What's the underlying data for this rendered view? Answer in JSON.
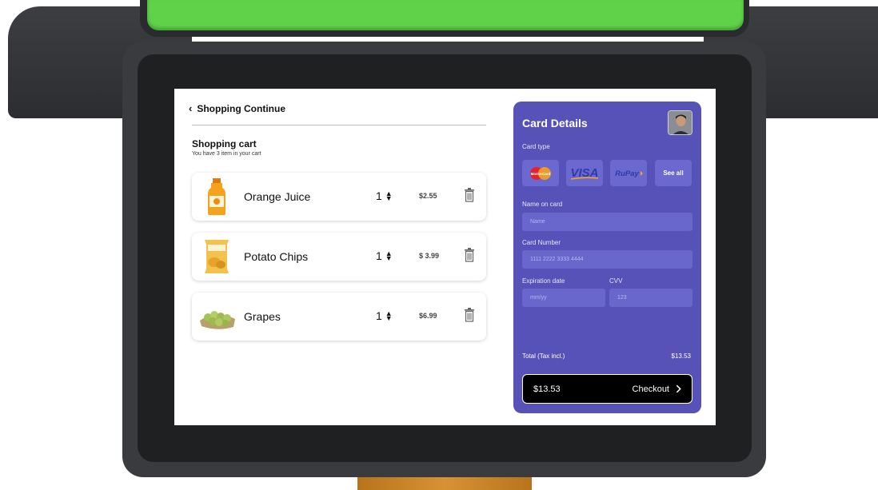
{
  "cart": {
    "back_label": "Shopping Continue",
    "title": "Shopping cart",
    "subtitle": "You have 3 item in your cart",
    "items": [
      {
        "name": "Orange Juice",
        "qty": "1",
        "price": "$2.55",
        "image": "orange-juice-bottle-icon"
      },
      {
        "name": "Potato Chips",
        "qty": "1",
        "price": "$ 3.99",
        "image": "potato-chips-bag-icon"
      },
      {
        "name": "Grapes",
        "qty": "1",
        "price": "$6.99",
        "image": "grapes-icon"
      }
    ]
  },
  "card": {
    "title": "Card Details",
    "card_type_label": "Card type",
    "brands": [
      {
        "name": "mastercard-logo",
        "text": "MasterCard"
      },
      {
        "name": "visa-logo",
        "text": "VISA"
      },
      {
        "name": "rupay-logo",
        "text": "RuPay"
      }
    ],
    "see_all": "See all",
    "name_label": "Name on card",
    "name_placeholder": "Name",
    "number_label": "Card Number",
    "number_placeholder": "1111 2222 3333 4444",
    "exp_label": "Expiration date",
    "exp_placeholder": "mm/yy",
    "cvv_label": "CVV",
    "cvv_placeholder": "123",
    "total_label": "Total (Tax incl.)",
    "total_value": "$13.53",
    "checkout_amount": "$13.53",
    "checkout_label": "Checkout"
  },
  "colors": {
    "panel": "#5652b8",
    "accent_green": "#5fd24a"
  }
}
